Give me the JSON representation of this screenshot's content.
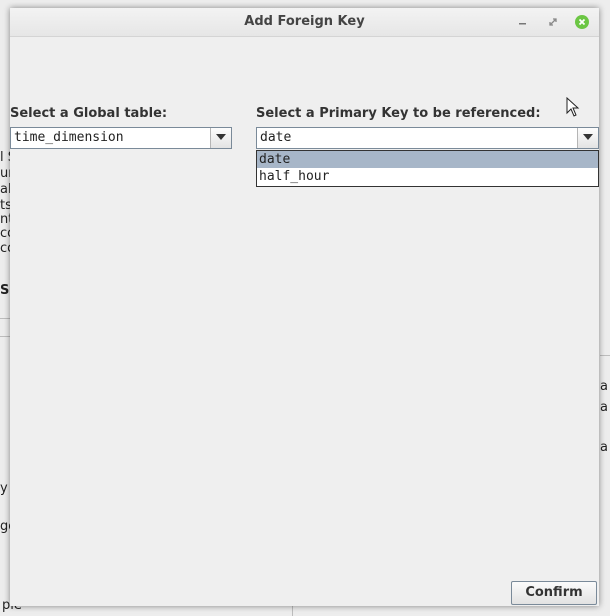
{
  "dialog": {
    "title": "Add Foreign Key"
  },
  "global_table": {
    "label": "Select a Global table:",
    "selected": "time_dimension"
  },
  "primary_key": {
    "label": "Select a Primary Key to be referenced:",
    "selected": "date",
    "options": [
      "date",
      "half_hour"
    ]
  },
  "actions": {
    "confirm_label": "Confirm"
  },
  "background_fragments": {
    "left_rows": [
      "l S",
      "un",
      "al",
      "ts",
      "nt",
      "co",
      "co"
    ],
    "left_heading": "S",
    "left_lower": [
      "y",
      "go",
      "ple"
    ],
    "right_rows": [
      "a",
      "a",
      "a"
    ]
  },
  "icons": {
    "minimize": "minimize-icon",
    "restore": "restore-icon",
    "close": "close-icon",
    "combo_arrow": "chevron-down-icon",
    "cursor": "mouse-pointer-icon"
  },
  "colors": {
    "close_button": "#6cc644",
    "selection": "#a7b6c8"
  }
}
